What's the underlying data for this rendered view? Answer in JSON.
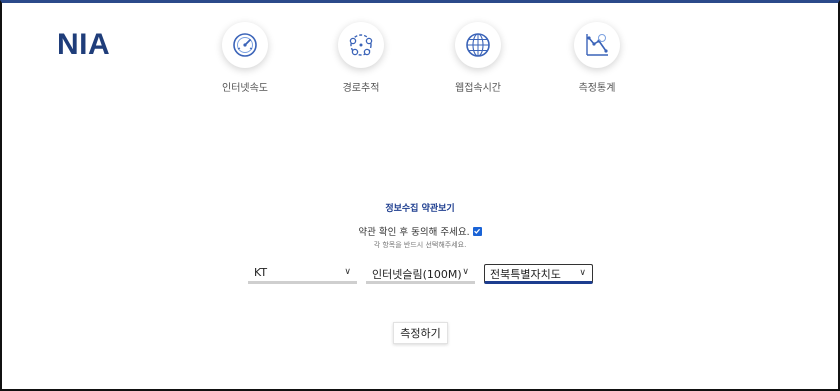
{
  "logo": {
    "text": "NIA"
  },
  "nav": {
    "items": [
      {
        "label": "인터넷속도",
        "icon": "speedometer-icon"
      },
      {
        "label": "경로추적",
        "icon": "route-trace-icon"
      },
      {
        "label": "웹접속시간",
        "icon": "globe-icon"
      },
      {
        "label": "측정통계",
        "icon": "statistics-icon"
      }
    ]
  },
  "terms": {
    "title": "정보수집 약관보기",
    "agree_label": "약관 확인 후 동의해 주세요.",
    "agree_checked": true,
    "note": "각 항목을 반드시 선택해주세요."
  },
  "selects": {
    "carrier": {
      "value": "KT"
    },
    "plan": {
      "value": "인터넷슬림(100M)"
    },
    "region": {
      "value": "전북특별자치도"
    }
  },
  "actions": {
    "measure_label": "측정하기"
  },
  "colors": {
    "brand": "#1f3d7a",
    "accent": "#1d3d8f",
    "checkbox": "#1a63d6"
  }
}
